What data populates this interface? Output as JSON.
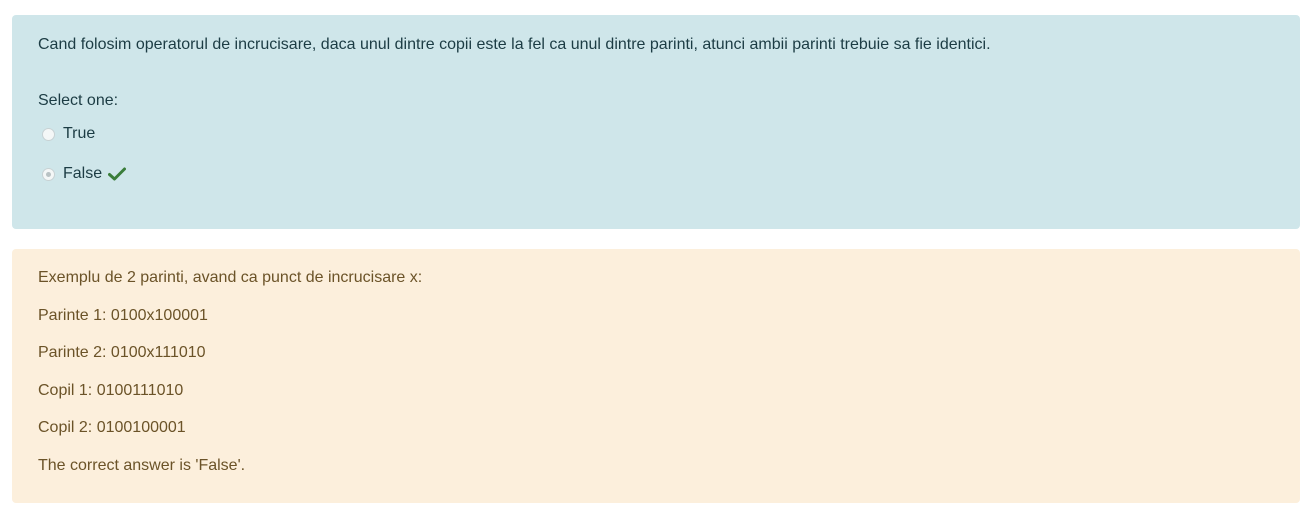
{
  "question": {
    "text": "Cand folosim operatorul de incrucisare, daca unul dintre copii este la fel ca unul dintre parinti, atunci ambii parinti trebuie sa fie identici.",
    "prompt": "Select one:",
    "options": [
      {
        "label": "True",
        "selected": false
      },
      {
        "label": "False",
        "selected": true,
        "marked_correct": true
      }
    ],
    "correct_icon": "checkmark-icon",
    "correct_color": "#3a7d3a"
  },
  "feedback": {
    "lines": [
      "Exemplu de 2 parinti, avand ca punct de incrucisare x:",
      "Parinte 1: 0100x100001",
      "Parinte 2: 0100x111010",
      "Copil 1: 0100111010",
      "Copil 2: 0100100001"
    ],
    "correct_answer": "The correct answer is 'False'."
  },
  "colors": {
    "question_bg": "#cfe6ea",
    "feedback_bg": "#fcefdc"
  }
}
